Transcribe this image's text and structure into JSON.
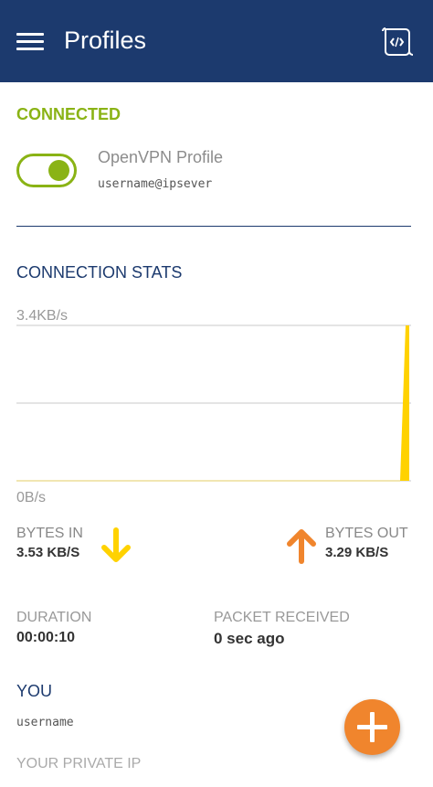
{
  "header": {
    "title": "Profiles",
    "menu_icon": "hamburger-menu-icon",
    "log_icon": "log-file-icon",
    "bg_color": "#1c3a6e"
  },
  "profile": {
    "status_label": "CONNECTED",
    "status_color": "#8ab315",
    "toggle_on": true,
    "name": "OpenVPN Profile",
    "user": "username@ipsever"
  },
  "stats": {
    "section_label": "CONNECTION STATS",
    "chart_data": {
      "type": "area",
      "title": "",
      "xlabel": "",
      "ylabel": "",
      "ymax_label": "3.4KB/s",
      "ymin_label": "0B/s",
      "ylim": [
        0,
        3.4
      ],
      "grid": true,
      "series": [
        {
          "color": "#ffd200",
          "values": [
            0,
            0,
            0,
            0,
            0,
            0,
            0,
            0,
            0,
            0,
            3.4
          ]
        }
      ]
    },
    "bytes_in_label": "BYTES IN",
    "bytes_in_value": "3.53 KB/S",
    "bytes_in_icon": "arrow-down-icon",
    "bytes_in_color": "#ffd200",
    "bytes_out_label": "BYTES OUT",
    "bytes_out_value": "3.29 KB/S",
    "bytes_out_icon": "arrow-up-icon",
    "bytes_out_color": "#f0852d",
    "duration_label": "DURATION",
    "duration_value": "00:00:10",
    "packet_label": "PACKET RECEIVED",
    "packet_value": "0 sec ago"
  },
  "you": {
    "section_label": "YOU",
    "user": "username",
    "private_ip_label": "YOUR PRIVATE IP"
  },
  "fab": {
    "icon": "plus-icon",
    "color": "#f0852d"
  }
}
